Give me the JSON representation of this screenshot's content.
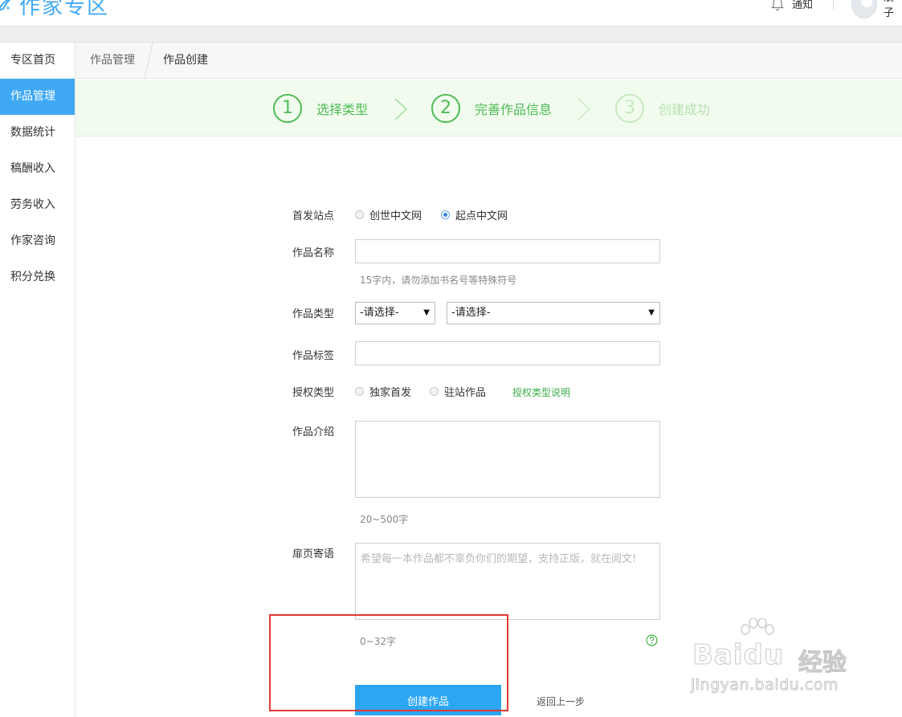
{
  "header": {
    "logo_text": "作家专区",
    "notify_label": "通知",
    "user_name": "浪子"
  },
  "sidebar": {
    "items": [
      {
        "label": "专区首页"
      },
      {
        "label": "作品管理"
      },
      {
        "label": "数据统计"
      },
      {
        "label": "稿酬收入"
      },
      {
        "label": "劳务收入"
      },
      {
        "label": "作家咨询"
      },
      {
        "label": "积分兑换"
      }
    ],
    "active_index": 1
  },
  "breadcrumb": {
    "parent": "作品管理",
    "current": "作品创建"
  },
  "steps": [
    {
      "number": "1",
      "label": "选择类型"
    },
    {
      "number": "2",
      "label": "完善作品信息"
    },
    {
      "number": "3",
      "label": "创建成功"
    }
  ],
  "form": {
    "site": {
      "label": "首发站点",
      "options": [
        "创世中文网",
        "起点中文网"
      ],
      "selected": "起点中文网"
    },
    "name": {
      "label": "作品名称",
      "value": "",
      "hint": "15字内，请勿添加书名号等特殊符号"
    },
    "type": {
      "label": "作品类型",
      "select1": "-请选择-",
      "select2": "-请选择-"
    },
    "tags": {
      "label": "作品标签",
      "value": ""
    },
    "license": {
      "label": "授权类型",
      "options": [
        "独家首发",
        "驻站作品"
      ],
      "link": "授权类型说明"
    },
    "intro": {
      "label": "作品介绍",
      "value": "",
      "hint": "20~500字"
    },
    "dedication": {
      "label": "扉页寄语",
      "placeholder": "希望每一本作品都不辜负你们的期望，支持正版，就在阅文!",
      "hint": "0~32字"
    }
  },
  "actions": {
    "create_label": "创建作品",
    "back_label": "返回上一步"
  },
  "watermark": {
    "brand": "Baidu",
    "suffix": "经验",
    "url": "jingyan.baidu.com"
  },
  "colors": {
    "accent_blue": "#3fa9f5",
    "button_blue": "#2ca6f2",
    "step_green": "#4fbb55",
    "link_green": "#3fae49",
    "highlight_red": "#e53935"
  },
  "icons": {
    "logo": "quill-logo-icon",
    "notify": "bell-icon",
    "help": "question-circle-icon"
  }
}
